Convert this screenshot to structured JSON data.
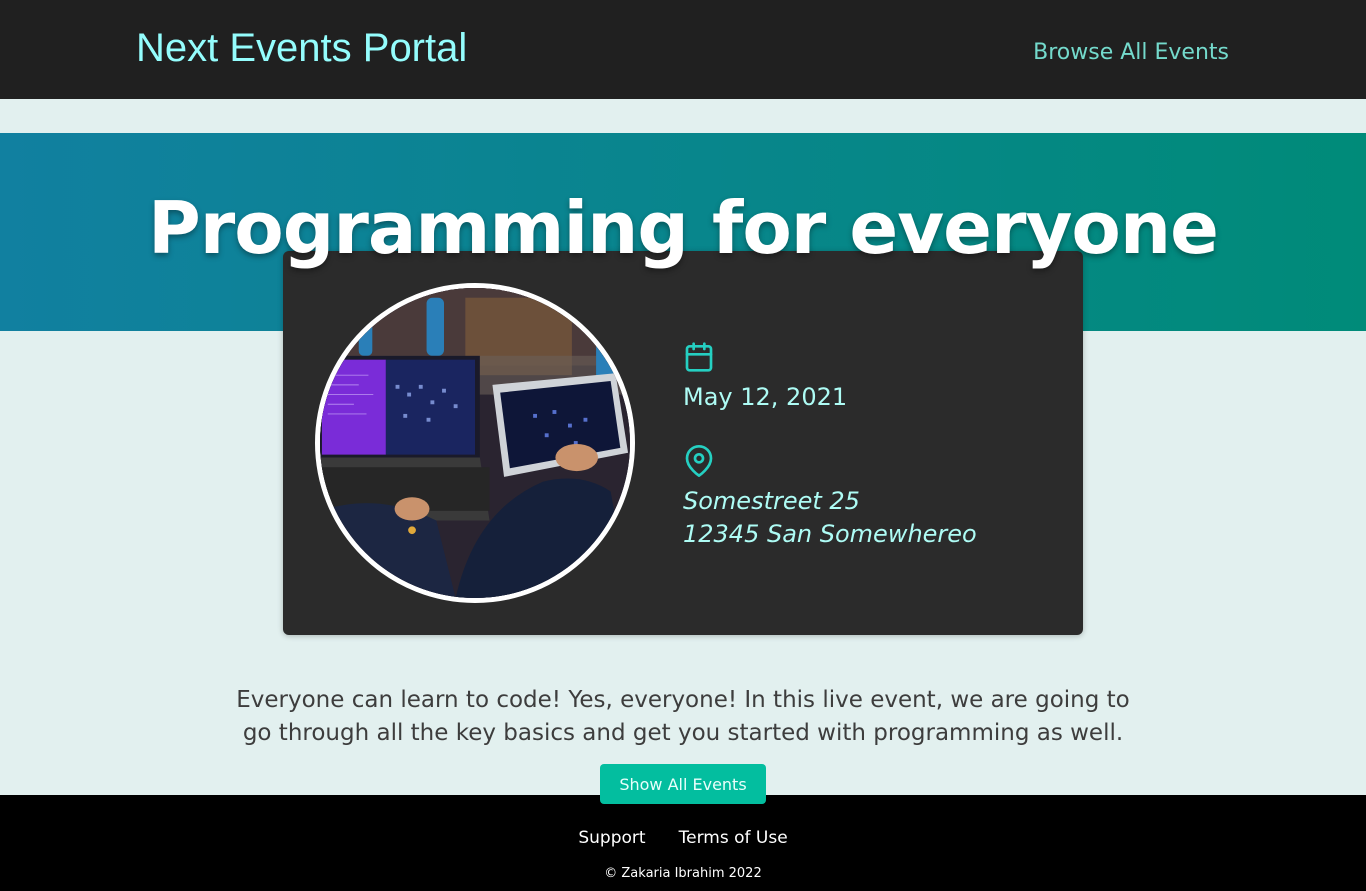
{
  "header": {
    "logo": "Next Events Portal",
    "nav_link": "Browse All Events"
  },
  "event": {
    "title": "Programming for everyone",
    "date": "May 12, 2021",
    "address_line1": "Somestreet 25",
    "address_line2": "12345 San Somewhereo",
    "description": "Everyone can learn to code! Yes, everyone! In this live event, we are going to go through all the key basics and get you started with programming as well.",
    "image_alt": "Programming for everyone",
    "date_icon": "calendar-icon",
    "address_icon": "location-pin-icon"
  },
  "actions": {
    "show_all": "Show All Events"
  },
  "footer": {
    "links": [
      "Support",
      "Terms of Use"
    ],
    "copyright": "© Zakaria Ibrahim 2022"
  },
  "colors": {
    "header_bg": "#202020",
    "logo": "#94fdfd",
    "nav_link": "#74dacc",
    "hero_gradient_start": "#008b79",
    "hero_gradient_end": "#1180a0",
    "card_bg": "#2b2b2b",
    "accent": "#25d0c2",
    "button": "#03be9f",
    "page_bg": "#e2f0ef",
    "footer_bg": "#000000"
  }
}
